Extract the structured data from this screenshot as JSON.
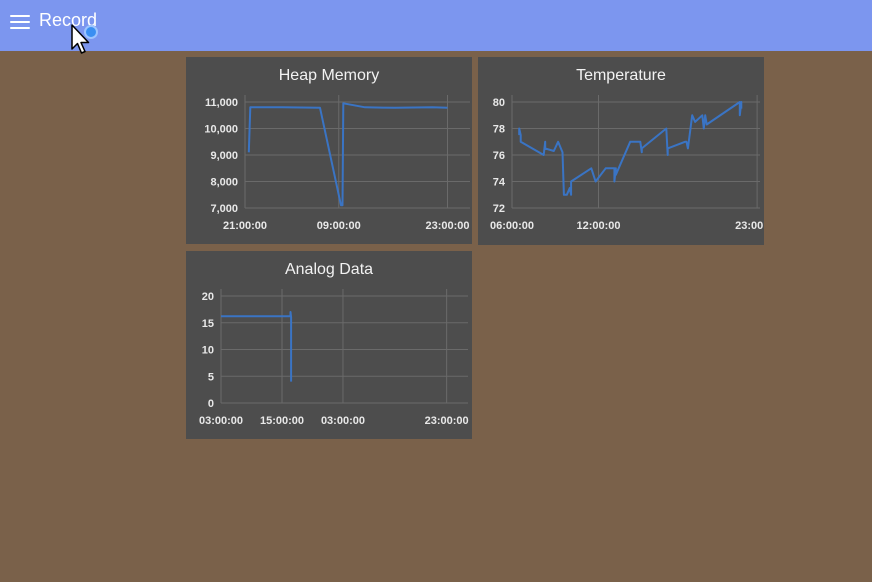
{
  "header": {
    "title": "Record",
    "menu_icon": "hamburger-menu-icon",
    "background": "#7c96ef"
  },
  "page": {
    "background": "#7a614a"
  },
  "cards": {
    "heap": {
      "title": "Heap Memory"
    },
    "temp": {
      "title": "Temperature"
    },
    "analog": {
      "title": "Analog Data"
    }
  },
  "chart_data": [
    {
      "id": "heap",
      "type": "line",
      "title": "Heap Memory",
      "color": "#3a74c4",
      "ylim": [
        7000,
        11000
      ],
      "yticks": [
        7000,
        8000,
        9000,
        10000,
        11000
      ],
      "ytick_labels": [
        "7,000",
        "8,000",
        "9,000",
        "10,000",
        "11,000"
      ],
      "xlim": [
        0,
        30
      ],
      "xtick_pos": [
        0,
        12.5,
        27
      ],
      "xtick_labels": [
        "21:00:00",
        "09:00:00",
        "23:00:00"
      ],
      "x": [
        0.5,
        0.7,
        5,
        10,
        12.8,
        13,
        13.1,
        16,
        20,
        25,
        27
      ],
      "y": [
        9100,
        10800,
        10800,
        10780,
        7100,
        7100,
        10950,
        10800,
        10780,
        10800,
        10780
      ]
    },
    {
      "id": "temp",
      "type": "line",
      "title": "Temperature",
      "color": "#3a74c4",
      "ylim": [
        72,
        80
      ],
      "yticks": [
        72,
        74,
        76,
        78,
        80
      ],
      "ytick_labels": [
        "72",
        "74",
        "76",
        "78",
        "80"
      ],
      "xlim": [
        6,
        23.2
      ],
      "xtick_pos": [
        6,
        12,
        23
      ],
      "xtick_labels": [
        "06:00:00",
        "12:00:00",
        "23:00:00"
      ],
      "x": [
        6.5,
        6.5,
        6.6,
        6.6,
        8.2,
        8.3,
        8.3,
        8.9,
        9.2,
        9.5,
        9.6,
        9.8,
        10.0,
        10.1,
        10.1,
        11.5,
        11.8,
        12.5,
        13.1,
        13.1,
        13.2,
        13.2,
        14.2,
        14.9,
        15.0,
        15.0,
        16.7,
        16.8,
        16.8,
        18.0,
        18.1,
        18.2,
        18.5,
        18.7,
        19.2,
        19.3,
        19.4,
        19.5,
        21.8,
        21.8,
        21.9,
        21.9
      ],
      "y": [
        77.5,
        78.0,
        77.5,
        77.0,
        76.0,
        77.0,
        76.5,
        76.3,
        77.0,
        76.2,
        73.0,
        73.0,
        73.5,
        73.0,
        74.0,
        75.0,
        74.0,
        75.0,
        75.0,
        74.0,
        75.0,
        74.5,
        77.0,
        77.0,
        76.2,
        76.5,
        78.0,
        76.0,
        76.5,
        77.0,
        77.0,
        76.5,
        79.0,
        78.5,
        79.0,
        78.0,
        79.0,
        78.3,
        80.0,
        79.0,
        80.0,
        79.5
      ]
    },
    {
      "id": "analog",
      "type": "line",
      "title": "Analog Data",
      "color": "#3a74c4",
      "ylim": [
        0,
        20
      ],
      "yticks": [
        0,
        5,
        10,
        15,
        20
      ],
      "ytick_labels": [
        "0",
        "5",
        "10",
        "15",
        "20"
      ],
      "xlim": [
        0,
        40.5
      ],
      "xtick_pos": [
        0,
        10,
        20,
        37
      ],
      "xtick_labels": [
        "03:00:00",
        "15:00:00",
        "03:00:00",
        "23:00:00"
      ],
      "x": [
        0,
        11.4,
        11.4,
        11.5,
        11.5
      ],
      "y": [
        16.2,
        16.2,
        17.0,
        16.0,
        4.0
      ]
    }
  ]
}
